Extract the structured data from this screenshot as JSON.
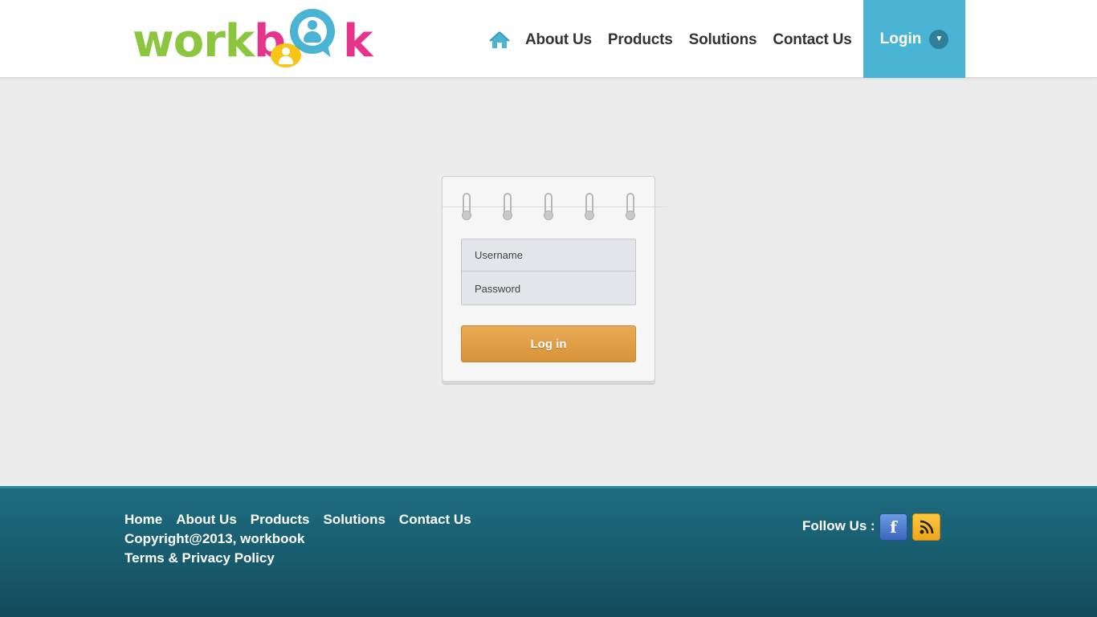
{
  "header": {
    "logo_text_part1": "work",
    "logo_text_part2": "b",
    "logo_text_part3": "k",
    "nav": [
      "About Us",
      "Products",
      "Solutions",
      "Contact Us"
    ],
    "login_label": "Login",
    "accent_color": "#4bb3d4"
  },
  "login_form": {
    "username_placeholder": "Username",
    "password_placeholder": "Password",
    "submit_label": "Log in",
    "button_color": "#e29f4a"
  },
  "footer": {
    "links": [
      "Home",
      "About Us",
      "Products",
      "Solutions",
      "Contact Us"
    ],
    "copyright": "Copyright@2013, workbook",
    "terms": "Terms & Privacy Policy",
    "follow_label": "Follow Us :",
    "social": [
      "facebook-icon",
      "rss-icon"
    ],
    "facebook_glyph": "f",
    "background_color": "#175a6c"
  }
}
